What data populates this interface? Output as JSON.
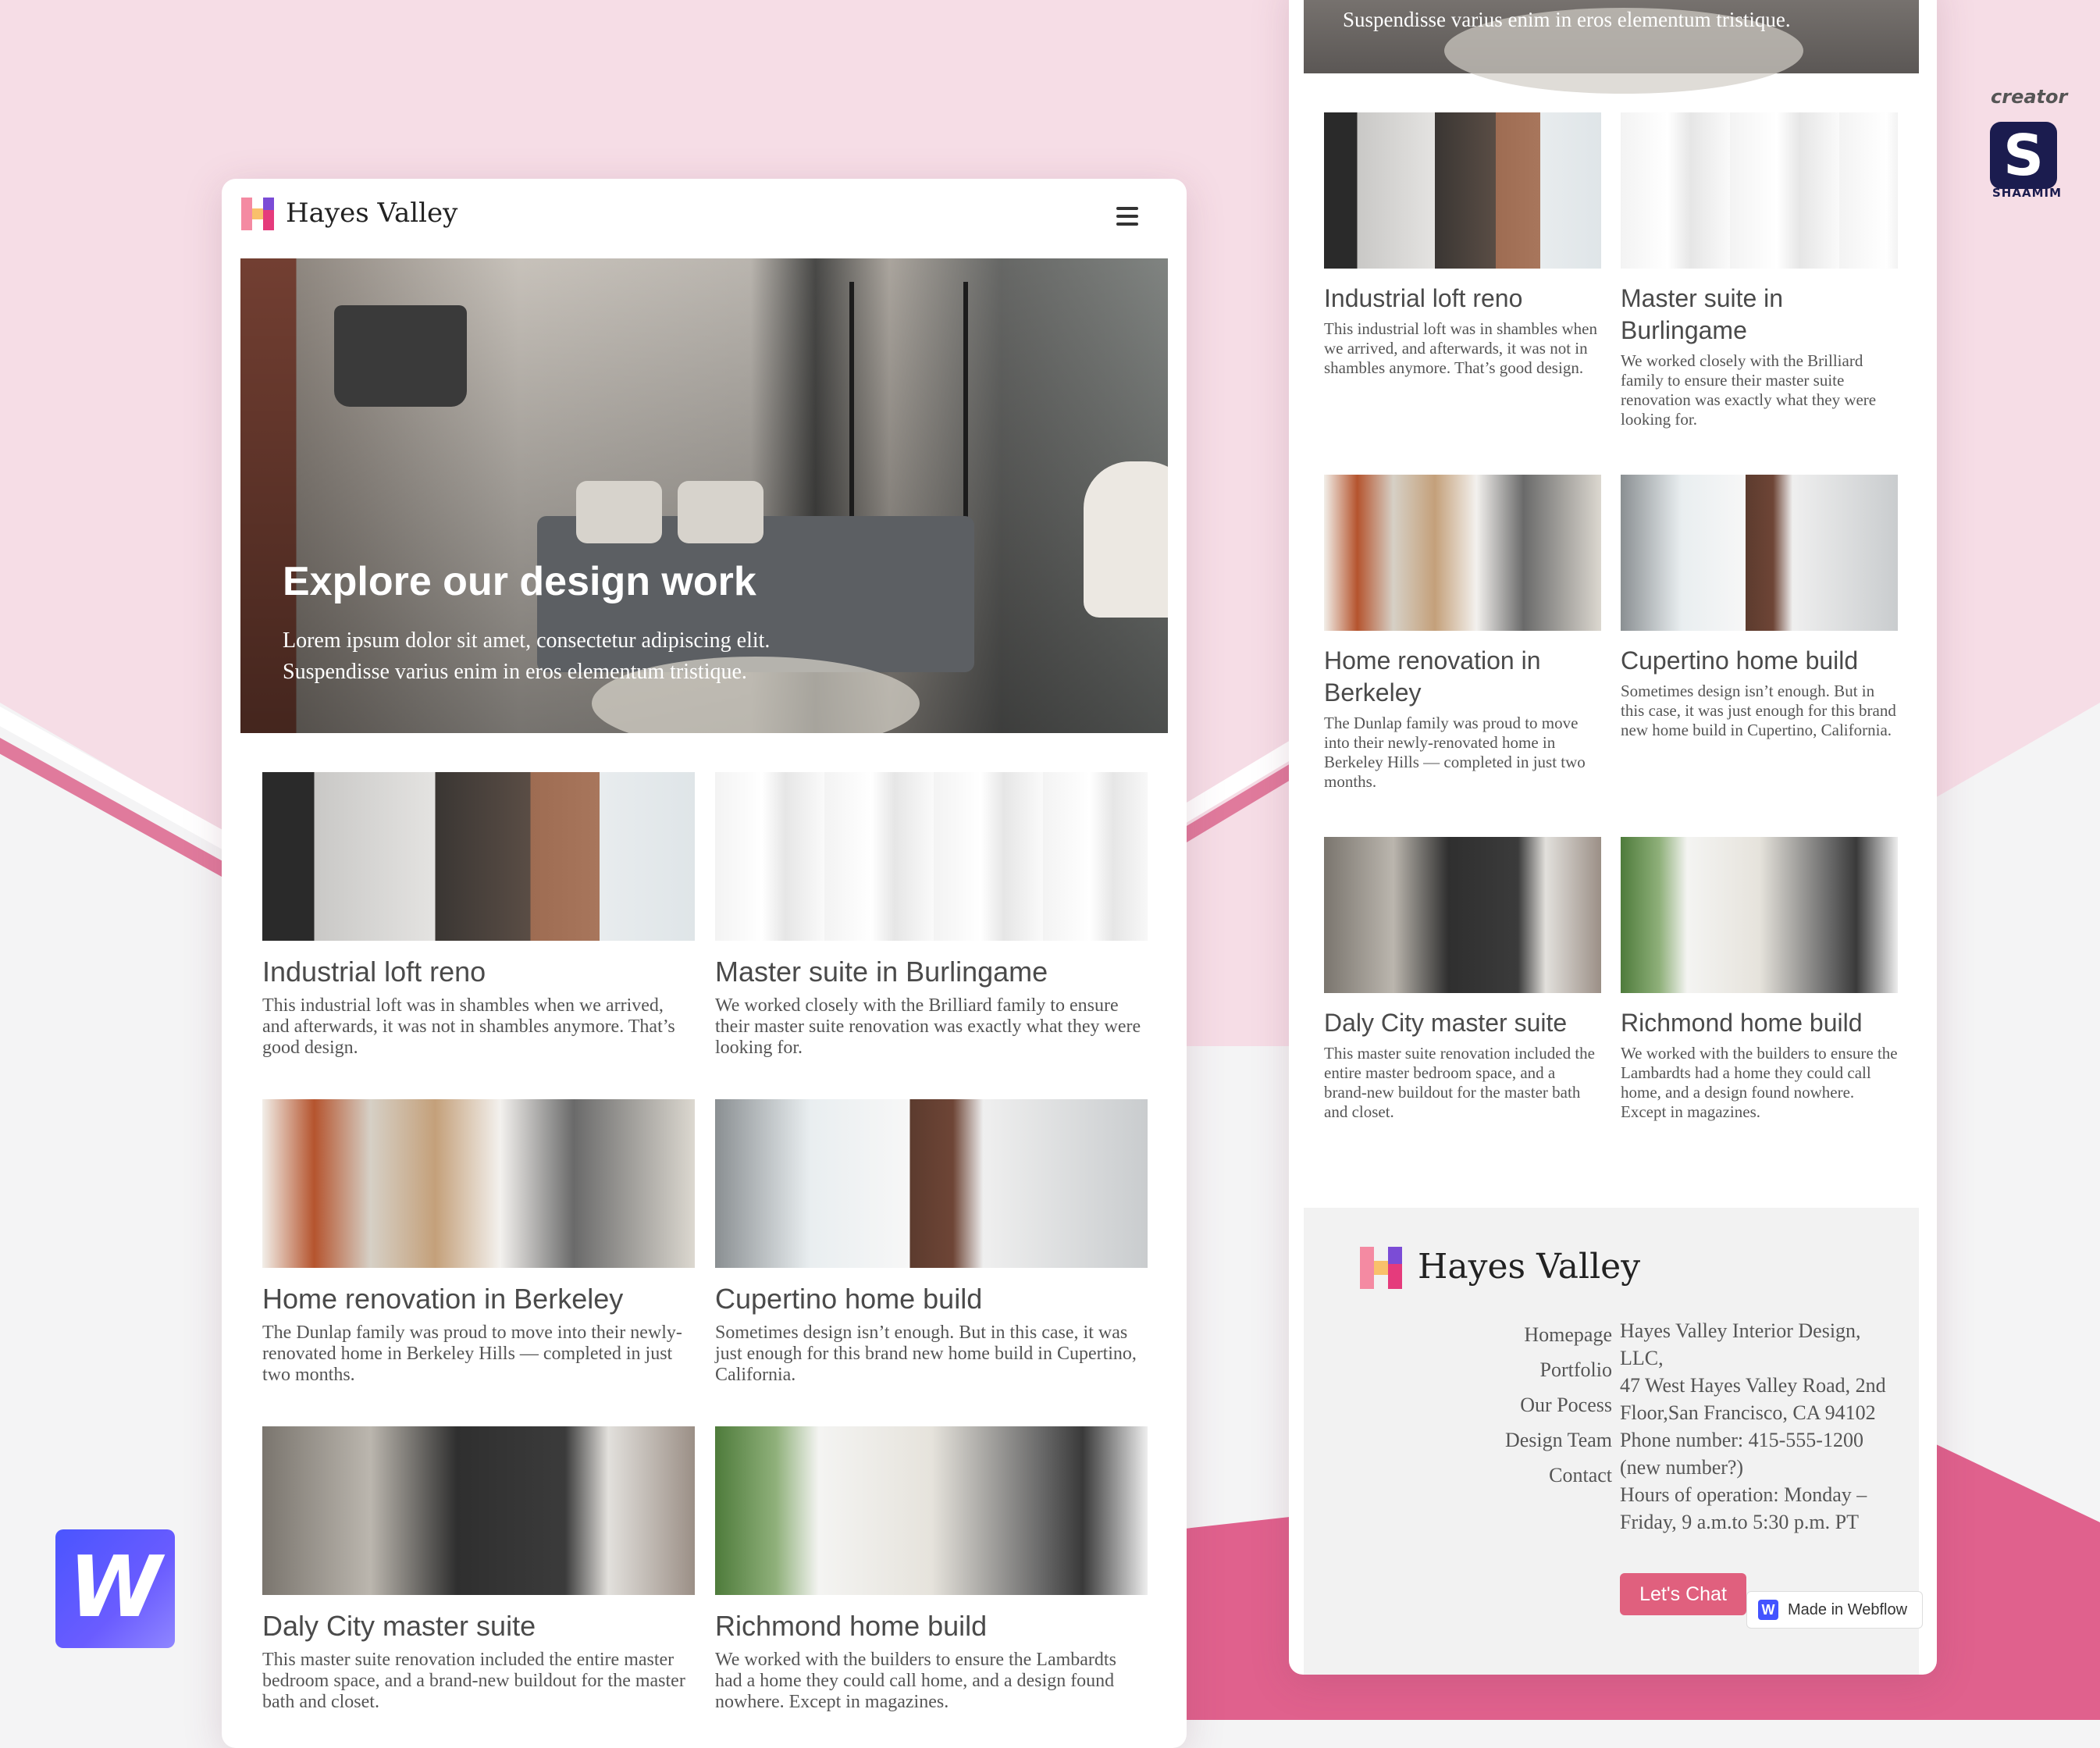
{
  "colors": {
    "accent": "#e0607e",
    "brand_pink": "#f6dde6",
    "webflow_blue": "#4353ff"
  },
  "left_page": {
    "brand": "Hayes Valley",
    "menu_icon": "hamburger-icon",
    "hero": {
      "title": "Explore our design work",
      "subtitle_line1": "Lorem ipsum dolor sit amet, consectetur adipiscing elit.",
      "subtitle_line2": "Suspendisse varius enim in eros elementum tristique."
    },
    "projects": [
      {
        "title": "Industrial loft reno",
        "desc": "This industrial loft was in shambles when we arrived, and afterwards, it was not in shambles anymore. That’s good design."
      },
      {
        "title": "Master suite in Burlingame",
        "desc": "We worked closely with the Brilliard family to ensure their master suite renovation was exactly what they were looking for."
      },
      {
        "title": "Home renovation in Berkeley",
        "desc": "The Dunlap family was proud to move into their newly-renovated home in Berkeley Hills — completed in just two months."
      },
      {
        "title": "Cupertino home build",
        "desc": "Sometimes design isn’t enough. But in this case, it was just enough for this brand new home build in Cupertino, California."
      },
      {
        "title": "Daly City master suite",
        "desc": "This master suite renovation included the entire master bedroom space, and a brand-new buildout for the master bath and closet."
      },
      {
        "title": "Richmond home build",
        "desc": "We worked with the builders to ensure the Lambardts had a home they could call home, and a design found nowhere. Except in magazines."
      }
    ]
  },
  "right_page": {
    "hero_subtitle": "Suspendisse varius enim in eros elementum tristique.",
    "projects": [
      {
        "title": "Industrial loft reno",
        "desc": "This industrial loft was in shambles when we arrived, and afterwards, it was not in shambles anymore. That’s good design."
      },
      {
        "title": "Master suite in Burlingame",
        "desc": "We worked closely with the Brilliard family to ensure their master suite renovation was exactly what they were looking for."
      },
      {
        "title": "Home renovation in Berkeley",
        "desc": "The Dunlap family was proud to move into their newly-renovated home in Berkeley Hills — completed in just two months."
      },
      {
        "title": "Cupertino home build",
        "desc": "Sometimes design isn’t enough. But in this case, it was just enough for this brand new home build in Cupertino, California."
      },
      {
        "title": "Daly City master suite",
        "desc": "This master suite renovation included the entire master bedroom space, and a brand-new buildout for the master bath and closet."
      },
      {
        "title": "Richmond home build",
        "desc": "We worked with the builders to ensure the Lambardts had a home they could call home, and a design found nowhere. Except in magazines."
      }
    ],
    "footer": {
      "brand": "Hayes Valley",
      "links": [
        "Homepage",
        "Portfolio",
        "Our Pocess",
        "Design Team",
        "Contact"
      ],
      "company": "Hayes Valley Interior Design, LLC,",
      "address": "47 West Hayes Valley Road, 2nd Floor,San Francisco, CA 94102",
      "phone": "Phone number: 415-555-1200 (new number?)",
      "hours": "Hours of operation: Monday – Friday, 9 a.m.to 5:30 p.m. PT",
      "chat_button": "Let's Chat",
      "badge": "Made in Webflow"
    }
  },
  "overlay": {
    "webflow_logo": "W",
    "creator_label": "creator",
    "creator_mark": "S",
    "creator_name": "SHAAMIM"
  }
}
